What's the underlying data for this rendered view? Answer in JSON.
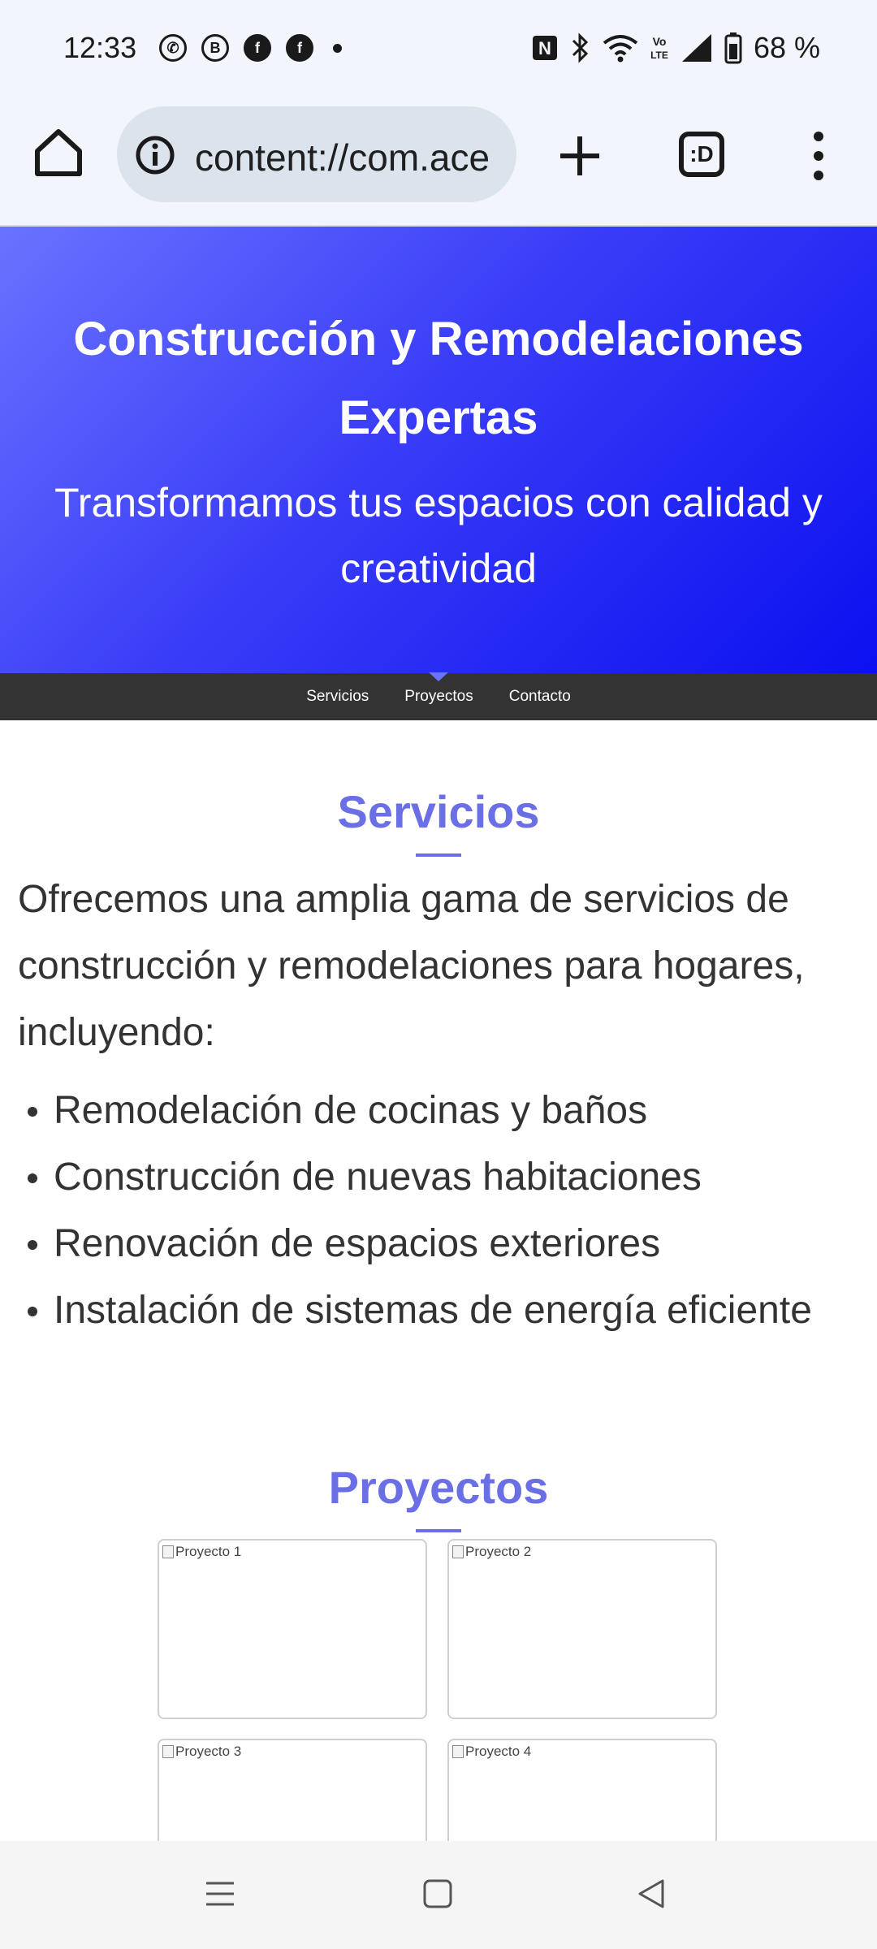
{
  "status_bar": {
    "time": "12:33",
    "battery": "68 %",
    "left_icons": [
      "whatsapp-icon",
      "business-whatsapp-icon",
      "facebook-icon",
      "facebook-icon",
      "more-notifications-dot"
    ],
    "right_icons": [
      "nfc-icon",
      "bluetooth-icon",
      "wifi-icon",
      "volte-icon",
      "signal-icon",
      "battery-icon"
    ]
  },
  "browser": {
    "url": "content://com.ace"
  },
  "hero": {
    "title": "Construcción y Remodelaciones Expertas",
    "subtitle": "Transformamos tus espacios con calidad y creatividad"
  },
  "nav": {
    "items": [
      "Servicios",
      "Proyectos",
      "Contacto"
    ]
  },
  "services": {
    "title": "Servicios",
    "intro": "Ofrecemos una amplia gama de servicios de construcción y remodelaciones para hogares, incluyendo:",
    "items": [
      "Remodelación de cocinas y baños",
      "Construcción de nuevas habitaciones",
      "Renovación de espacios exteriores",
      "Instalación de sistemas de energía eficiente"
    ]
  },
  "projects": {
    "title": "Proyectos",
    "images": [
      "Proyecto 1",
      "Proyecto 2",
      "Proyecto 3",
      "Proyecto 4"
    ]
  },
  "colors": {
    "accent": "#6b6fe6",
    "hero_start": "#6a72ff",
    "hero_end": "#0b10f0",
    "nav_bg": "#333333"
  }
}
